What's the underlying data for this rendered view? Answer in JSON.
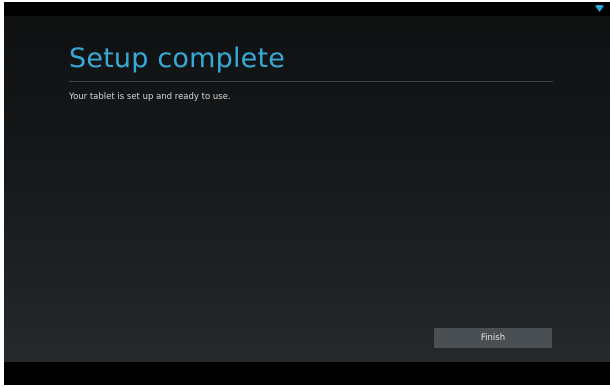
{
  "app": {
    "accent_color": "#36a9d6",
    "status_icons": [
      "wifi-icon"
    ]
  },
  "setup": {
    "title": "Setup complete",
    "message": "Your tablet is set up and ready to use.",
    "finish_label": "Finish"
  }
}
